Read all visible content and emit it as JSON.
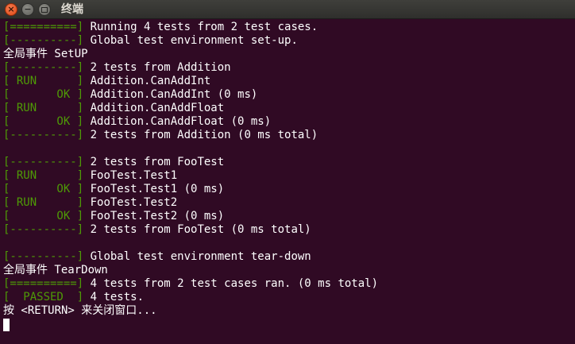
{
  "window": {
    "title": "终端",
    "close_glyph": "×",
    "minimize_glyph": "−"
  },
  "terminal": {
    "lines": [
      {
        "tag": "[==========]",
        "text": " Running 4 tests from 2 test cases."
      },
      {
        "tag": "[----------]",
        "text": " Global test environment set-up."
      },
      {
        "tag": "",
        "text": "全局事件 SetUP"
      },
      {
        "tag": "[----------]",
        "text": " 2 tests from Addition"
      },
      {
        "tag": "[ RUN      ]",
        "text": " Addition.CanAddInt"
      },
      {
        "tag": "[       OK ]",
        "text": " Addition.CanAddInt (0 ms)"
      },
      {
        "tag": "[ RUN      ]",
        "text": " Addition.CanAddFloat"
      },
      {
        "tag": "[       OK ]",
        "text": " Addition.CanAddFloat (0 ms)"
      },
      {
        "tag": "[----------]",
        "text": " 2 tests from Addition (0 ms total)"
      },
      {
        "tag": "",
        "text": ""
      },
      {
        "tag": "[----------]",
        "text": " 2 tests from FooTest"
      },
      {
        "tag": "[ RUN      ]",
        "text": " FooTest.Test1"
      },
      {
        "tag": "[       OK ]",
        "text": " FooTest.Test1 (0 ms)"
      },
      {
        "tag": "[ RUN      ]",
        "text": " FooTest.Test2"
      },
      {
        "tag": "[       OK ]",
        "text": " FooTest.Test2 (0 ms)"
      },
      {
        "tag": "[----------]",
        "text": " 2 tests from FooTest (0 ms total)"
      },
      {
        "tag": "",
        "text": ""
      },
      {
        "tag": "[----------]",
        "text": " Global test environment tear-down"
      },
      {
        "tag": "",
        "text": "全局事件 TearDown"
      },
      {
        "tag": "[==========]",
        "text": " 4 tests from 2 test cases ran. (0 ms total)"
      },
      {
        "tag": "[  PASSED  ]",
        "text": " 4 tests."
      },
      {
        "tag": "",
        "text": "按 <RETURN> 来关闭窗口..."
      }
    ]
  },
  "colors": {
    "background": "#300a24",
    "text": "#ffffff",
    "tag_green": "#4e9a06"
  }
}
